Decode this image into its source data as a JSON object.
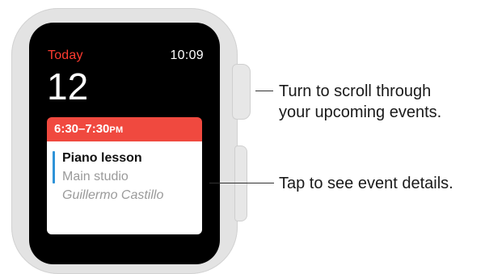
{
  "watch": {
    "screen": {
      "today_label": "Today",
      "time": "10:09",
      "day_number": "12",
      "event": {
        "time_range": "6:30–7:30",
        "time_suffix": "PM",
        "title": "Piano lesson",
        "location": "Main studio",
        "person": "Guillermo Castillo"
      }
    },
    "icons": {
      "digital_crown": "digital-crown-icon",
      "side_button": "side-button-icon"
    }
  },
  "callouts": {
    "crown_line1": "Turn to scroll through",
    "crown_line2": "your upcoming events.",
    "event_text": "Tap to see event details."
  },
  "colors": {
    "accent_red": "#ff3b30",
    "event_header": "#f0493f",
    "calendar_bar": "#2f93d8",
    "case": "#e3e3e3"
  }
}
